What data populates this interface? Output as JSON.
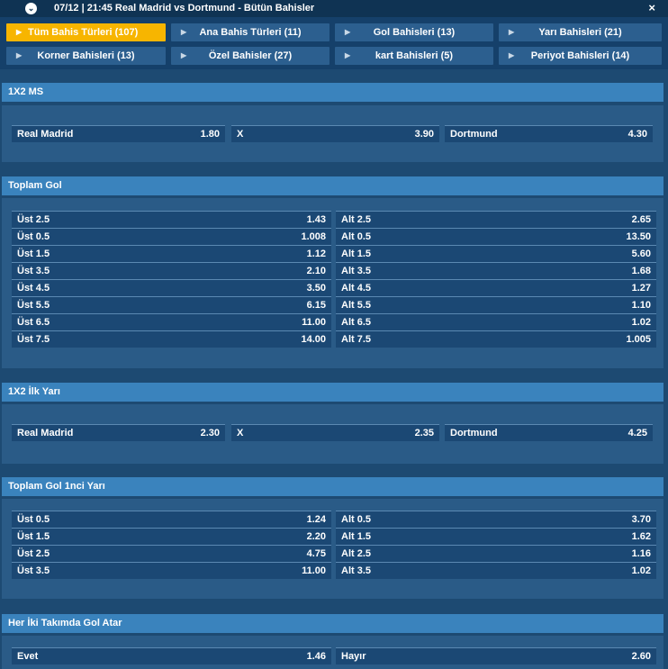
{
  "header": {
    "title": "07/12 | 21:45 Real Madrid vs Dortmund - Bütün Bahisler",
    "close": "×",
    "chevron": "⌄"
  },
  "tabs": [
    {
      "label": "Tüm Bahis Türleri (107)",
      "active": true
    },
    {
      "label": "Ana Bahis Türleri (11)"
    },
    {
      "label": "Gol Bahisleri (13)"
    },
    {
      "label": "Yarı Bahisleri (21)"
    },
    {
      "label": "Korner Bahisleri (13)"
    },
    {
      "label": "Özel Bahisler (27)"
    },
    {
      "label": "kart Bahisleri (5)"
    },
    {
      "label": "Periyot Bahisleri (14)"
    }
  ],
  "sections": {
    "ms": {
      "title": "1X2 MS",
      "odds": [
        {
          "name": "Real Madrid",
          "value": "1.80"
        },
        {
          "name": "X",
          "value": "3.90"
        },
        {
          "name": "Dortmund",
          "value": "4.30"
        }
      ]
    },
    "toplam": {
      "title": "Toplam Gol",
      "rows": [
        {
          "left": {
            "name": "Üst 2.5",
            "value": "1.43"
          },
          "right": {
            "name": "Alt 2.5",
            "value": "2.65"
          }
        },
        {
          "left": {
            "name": "Üst 0.5",
            "value": "1.008"
          },
          "right": {
            "name": "Alt 0.5",
            "value": "13.50"
          }
        },
        {
          "left": {
            "name": "Üst 1.5",
            "value": "1.12"
          },
          "right": {
            "name": "Alt 1.5",
            "value": "5.60"
          }
        },
        {
          "left": {
            "name": "Üst 3.5",
            "value": "2.10"
          },
          "right": {
            "name": "Alt 3.5",
            "value": "1.68"
          }
        },
        {
          "left": {
            "name": "Üst 4.5",
            "value": "3.50"
          },
          "right": {
            "name": "Alt 4.5",
            "value": "1.27"
          }
        },
        {
          "left": {
            "name": "Üst 5.5",
            "value": "6.15"
          },
          "right": {
            "name": "Alt 5.5",
            "value": "1.10"
          }
        },
        {
          "left": {
            "name": "Üst 6.5",
            "value": "11.00"
          },
          "right": {
            "name": "Alt 6.5",
            "value": "1.02"
          }
        },
        {
          "left": {
            "name": "Üst 7.5",
            "value": "14.00"
          },
          "right": {
            "name": "Alt 7.5",
            "value": "1.005"
          }
        }
      ]
    },
    "iy": {
      "title": "1X2 İlk Yarı",
      "odds": [
        {
          "name": "Real Madrid",
          "value": "2.30"
        },
        {
          "name": "X",
          "value": "2.35"
        },
        {
          "name": "Dortmund",
          "value": "4.25"
        }
      ]
    },
    "toplam1": {
      "title": "Toplam Gol 1nci Yarı",
      "rows": [
        {
          "left": {
            "name": "Üst 0.5",
            "value": "1.24"
          },
          "right": {
            "name": "Alt 0.5",
            "value": "3.70"
          }
        },
        {
          "left": {
            "name": "Üst 1.5",
            "value": "2.20"
          },
          "right": {
            "name": "Alt 1.5",
            "value": "1.62"
          }
        },
        {
          "left": {
            "name": "Üst 2.5",
            "value": "4.75"
          },
          "right": {
            "name": "Alt 2.5",
            "value": "1.16"
          }
        },
        {
          "left": {
            "name": "Üst 3.5",
            "value": "11.00"
          },
          "right": {
            "name": "Alt 3.5",
            "value": "1.02"
          }
        }
      ]
    },
    "kg": {
      "title": "Her İki Takımda Gol Atar",
      "rows": [
        {
          "left": {
            "name": "Evet",
            "value": "1.46"
          },
          "right": {
            "name": "Hayır",
            "value": "2.60"
          }
        }
      ]
    }
  },
  "colors": {
    "background": "#1d4a72",
    "section_header": "#3a83bd",
    "active_tab": "#f7b500",
    "odd_row": "#1b4874"
  },
  "icons": {
    "tab_arrow": "triangle-right-icon"
  }
}
